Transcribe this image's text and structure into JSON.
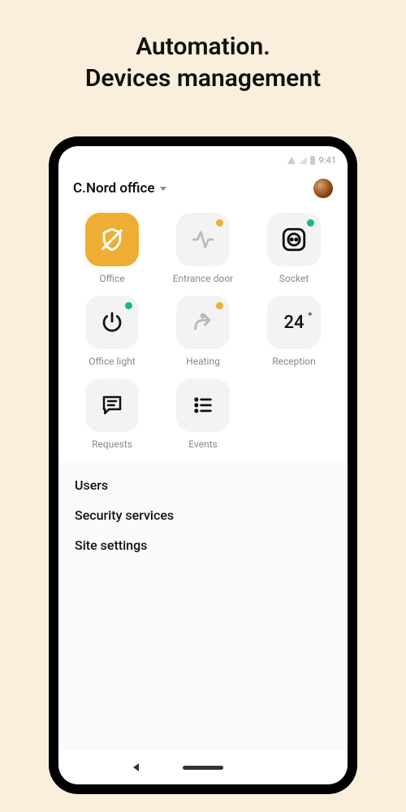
{
  "headline": {
    "line1": "Automation.",
    "line2": "Devices management"
  },
  "statusbar": {
    "time": "9:41"
  },
  "location": {
    "name": "C.Nord office"
  },
  "tiles": [
    {
      "label": "Office"
    },
    {
      "label": "Entrance door"
    },
    {
      "label": "Socket"
    },
    {
      "label": "Office light"
    },
    {
      "label": "Heating"
    },
    {
      "label": "Reception",
      "temp": "24"
    },
    {
      "label": "Requests"
    },
    {
      "label": "Events"
    }
  ],
  "menu": {
    "users": "Users",
    "security": "Security services",
    "settings": "Site settings"
  }
}
